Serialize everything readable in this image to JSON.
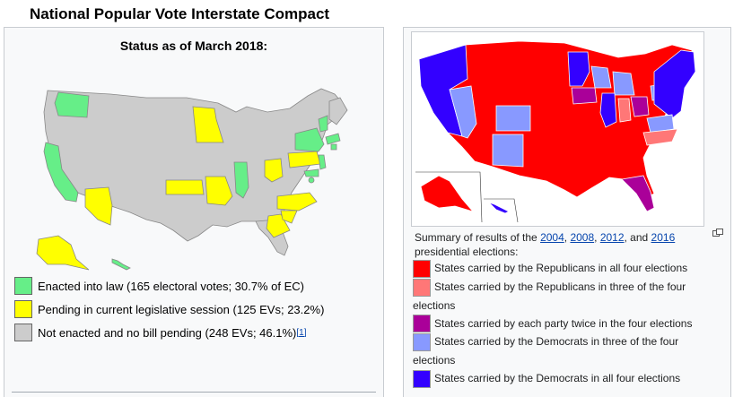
{
  "heading": "National Popular Vote Interstate Compact",
  "left_panel": {
    "status_title": "Status as of March 2018:",
    "legend": [
      {
        "label": "Enacted into law (165 electoral votes; 30.7% of EC)",
        "color": "#66ee88"
      },
      {
        "label": "Pending in current legislative session (125 EVs; 23.2%)",
        "color": "#ffff00"
      },
      {
        "label": "Not enacted and no bill pending (248 EVs; 46.1%)",
        "color": "#cccccc",
        "citation": "[1]"
      }
    ]
  },
  "right_panel": {
    "caption_prefix": "Summary of results of the ",
    "years": [
      "2004",
      "2008",
      "2012",
      "2016"
    ],
    "sep1": ", ",
    "sep2": ", ",
    "sep3": ", and ",
    "caption_suffix": " presidential elections:",
    "legend": [
      {
        "label": "States carried by the Republicans in all four elections",
        "color": "#ff0000"
      },
      {
        "label": "States carried by the Republicans in three of the four elections",
        "color": "#ff7777"
      },
      {
        "label": "States carried by each party twice in the four elections",
        "color": "#aa0099"
      },
      {
        "label": "States carried by the Democrats in three of the four elections",
        "color": "#8899ff"
      },
      {
        "label": "States carried by the Democrats in all four elections",
        "color": "#3300ff"
      }
    ]
  },
  "colors": {
    "enacted": "#66ee88",
    "pending": "#ffff00",
    "none": "#cccccc",
    "rep4": "#ff0000",
    "rep3": "#ff7777",
    "split": "#aa0099",
    "dem3": "#8899ff",
    "dem4": "#3300ff"
  },
  "icons": {
    "enlarge": "enlarge-icon",
    "map_left": "us-map-compact-status",
    "map_right": "us-map-election-summary"
  }
}
